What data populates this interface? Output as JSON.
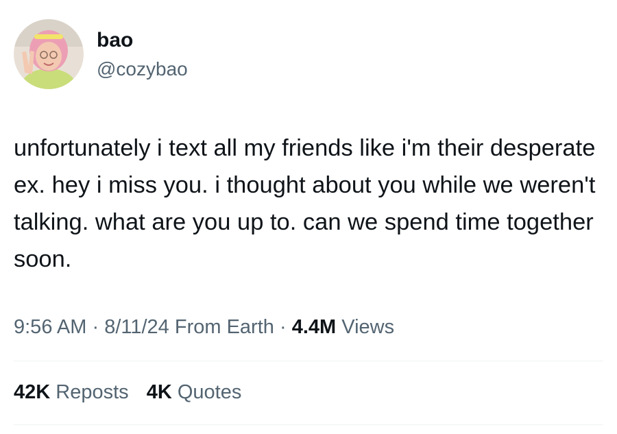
{
  "user": {
    "display_name": "bao",
    "handle": "@cozybao",
    "avatar_icon": "profile-photo-avatar"
  },
  "tweet": {
    "text": "unfortunately i text all my friends like i'm their desperate ex. hey i miss you. i thought about you while we weren't talking. what are you up to. can we spend time together soon."
  },
  "meta": {
    "time": "9:56 AM",
    "separator": "·",
    "date": "8/11/24",
    "source": "From Earth",
    "views_count": "4.4M",
    "views_label": "Views"
  },
  "stats": {
    "reposts_count": "42K",
    "reposts_label": "Reposts",
    "quotes_count": "4K",
    "quotes_label": "Quotes"
  },
  "colors": {
    "text_primary": "#0f1419",
    "text_secondary": "#536471",
    "divider": "#eff3f4",
    "background": "#ffffff"
  }
}
